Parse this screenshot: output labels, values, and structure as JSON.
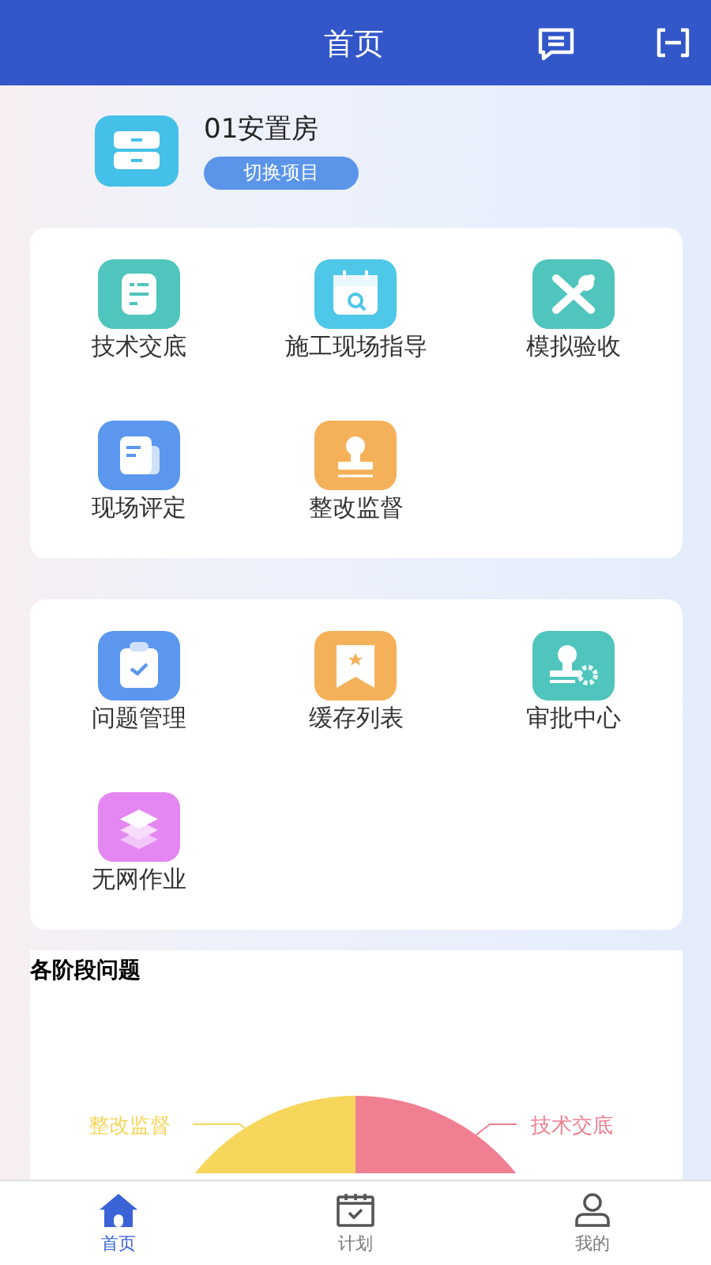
{
  "header": {
    "title": "首页"
  },
  "project": {
    "name": "01安置房",
    "switch_button": "切换项目"
  },
  "menu_groups": [
    {
      "items": [
        {
          "label": "技术交底"
        },
        {
          "label": "施工现场指导"
        },
        {
          "label": "模拟验收"
        },
        {
          "label": "现场评定"
        },
        {
          "label": "整改监督"
        }
      ]
    },
    {
      "items": [
        {
          "label": "问题管理"
        },
        {
          "label": "缓存列表"
        },
        {
          "label": "审批中心"
        },
        {
          "label": "无网作业"
        }
      ]
    }
  ],
  "chart": {
    "title": "各阶段问题",
    "slices": [
      {
        "label": "整改监督",
        "color": "#f7d65c"
      },
      {
        "label": "技术交底",
        "color": "#f07f91"
      }
    ]
  },
  "tab_bar": [
    {
      "label": "首页",
      "selected": true
    },
    {
      "label": "计划",
      "selected": false
    },
    {
      "label": "我的",
      "selected": false
    }
  ]
}
